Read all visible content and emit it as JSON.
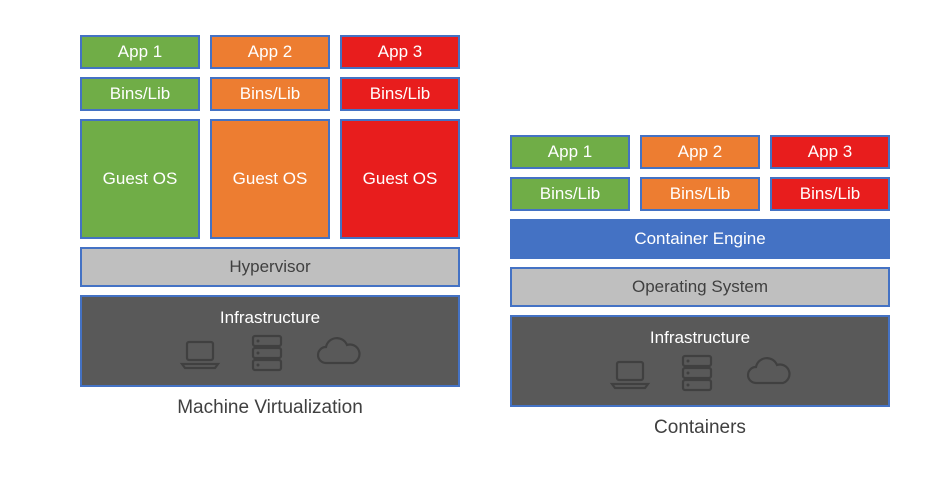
{
  "left": {
    "apps": [
      "App 1",
      "App 2",
      "App 3"
    ],
    "bins": [
      "Bins/Lib",
      "Bins/Lib",
      "Bins/Lib"
    ],
    "guest": [
      "Guest OS",
      "Guest OS",
      "Guest OS"
    ],
    "hypervisor": "Hypervisor",
    "infrastructure": "Infrastructure",
    "caption": "Machine Virtualization"
  },
  "right": {
    "apps": [
      "App 1",
      "App 2",
      "App 3"
    ],
    "bins": [
      "Bins/Lib",
      "Bins/Lib",
      "Bins/Lib"
    ],
    "engine": "Container Engine",
    "os": "Operating System",
    "infrastructure": "Infrastructure",
    "caption": "Containers"
  },
  "colors": {
    "col1": "#70AD47",
    "col2": "#ED7D31",
    "col3": "#E81D1D",
    "engine": "#4472C4",
    "lightgray": "#BFBFBF",
    "darkgray": "#595959",
    "border": "#4472C4"
  },
  "icons": [
    "laptop",
    "server",
    "cloud"
  ]
}
